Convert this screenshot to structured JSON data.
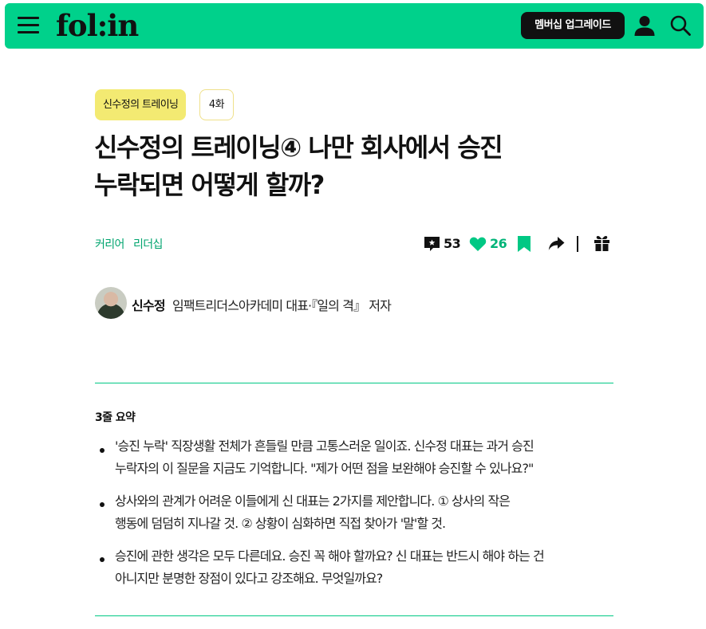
{
  "header": {
    "logo": "fol:in",
    "upgrade_label": "멤버십 업그레이드",
    "icons": [
      "hamburger-icon",
      "user-icon",
      "search-icon"
    ],
    "accent_color": "#00d18b"
  },
  "article": {
    "series_tag": "신수정의 트레이닝",
    "episode_tag": "4화",
    "title_line1": "신수정의 트레이닝④ 나만 회사에서 승진",
    "title_line2": "누락되면 어떻게 할까?",
    "categories": [
      "커리어",
      "리더십"
    ],
    "comment_count": "53",
    "like_count": "26",
    "action_icons": [
      "comment-icon",
      "heart-icon",
      "bookmark-icon",
      "share-icon",
      "gift-icon"
    ],
    "category_color": "#00a46e"
  },
  "author": {
    "name": "신수정",
    "description": "임팩트리더스아카데미 대표·『일의 격』 저자"
  },
  "summary": {
    "heading": "3줄 요약",
    "items": [
      {
        "line1": "'승진 누락' 직장생활 전체가 흔들릴 만큼 고통스러운 일이죠. 신수정 대표는 과거 승진",
        "line2": "누락자의 이 질문을 지금도 기억합니다. \"제가 어떤 점을 보완해야 승진할 수 있나요?\""
      },
      {
        "line1": "상사와의 관계가 어려운 이들에게 신 대표는 2가지를 제안합니다. ① 상사의 작은",
        "line2": "행동에 덤덤히 지나갈 것. ② 상황이 심화하면 직접 찾아가 '말'할 것."
      },
      {
        "line1": "승진에 관한 생각은 모두 다른데요. 승진 꼭 해야 할까요? 신 대표는 반드시 해야 하는 건",
        "line2": "아니지만 분명한 장점이 있다고 강조해요. 무엇일까요?"
      }
    ]
  }
}
